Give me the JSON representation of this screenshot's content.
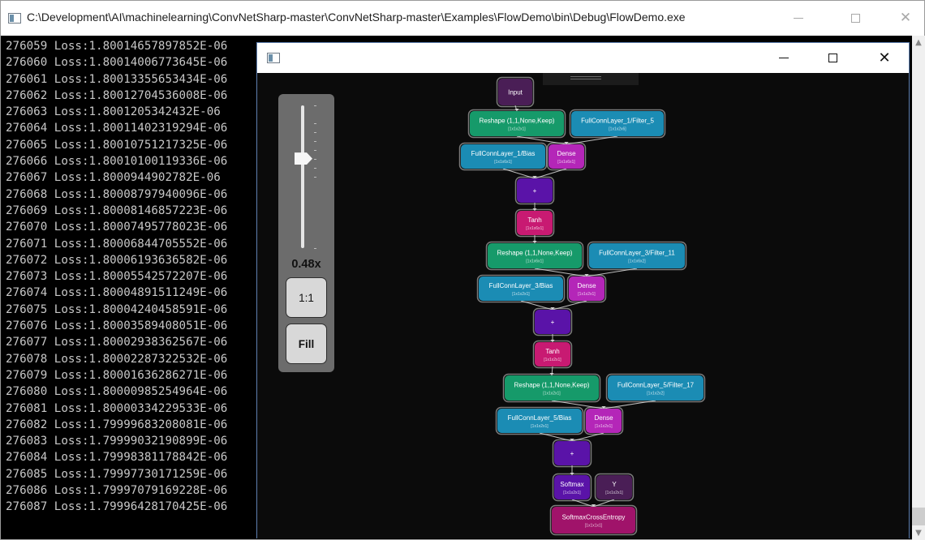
{
  "console": {
    "title": "C:\\Development\\AI\\machinelearning\\ConvNetSharp-master\\ConvNetSharp-master\\Examples\\FlowDemo\\bin\\Debug\\FlowDemo.exe",
    "lines": [
      "276059 Loss:1.80014657897852E-06",
      "276060 Loss:1.80014006773645E-06",
      "276061 Loss:1.80013355653434E-06",
      "276062 Loss:1.80012704536008E-06",
      "276063 Loss:1.8001205342432E-06",
      "276064 Loss:1.80011402319294E-06",
      "276065 Loss:1.80010751217325E-06",
      "276066 Loss:1.80010100119336E-06",
      "276067 Loss:1.8000944902782E-06",
      "276068 Loss:1.80008797940096E-06",
      "276069 Loss:1.80008146857223E-06",
      "276070 Loss:1.80007495778023E-06",
      "276071 Loss:1.80006844705552E-06",
      "276072 Loss:1.80006193636582E-06",
      "276073 Loss:1.80005542572207E-06",
      "276074 Loss:1.80004891511249E-06",
      "276075 Loss:1.80004240458591E-06",
      "276076 Loss:1.80003589408051E-06",
      "276077 Loss:1.80002938362567E-06",
      "276078 Loss:1.80002287322532E-06",
      "276079 Loss:1.80001636286271E-06",
      "276080 Loss:1.80000985254964E-06",
      "276081 Loss:1.80000334229533E-06",
      "276082 Loss:1.79999683208081E-06",
      "276083 Loss:1.79999032190899E-06",
      "276084 Loss:1.79998381178842E-06",
      "276085 Loss:1.79997730171259E-06",
      "276086 Loss:1.79997079169228E-06",
      "276087 Loss:1.79996428170425E-06"
    ]
  },
  "flow_window": {
    "zoom": {
      "label": "0.48x",
      "level_fraction": 0.63,
      "one_to_one_label": "1:1",
      "fill_label": "Fill"
    },
    "graph": {
      "nodes": [
        {
          "id": "input",
          "label": "Input",
          "sub": "",
          "color": "#4a1e56"
        },
        {
          "id": "reshape1",
          "label": "Reshape (1,1,None,Keep)",
          "sub": "[1x1x2x1]",
          "color": "#169a6a"
        },
        {
          "id": "filter1",
          "label": "FullConnLayer_1/Filter_5",
          "sub": "[1x1x2x6]",
          "color": "#1b8cb4"
        },
        {
          "id": "bias1",
          "label": "FullConnLayer_1/Bias",
          "sub": "[1x1x6x1]",
          "color": "#1b8cb4"
        },
        {
          "id": "dense1",
          "label": "Dense",
          "sub": "[1x1x6x1]",
          "color": "#b426b8"
        },
        {
          "id": "add1",
          "label": "+",
          "sub": "",
          "color": "#5a13a8"
        },
        {
          "id": "tanh1",
          "label": "Tanh",
          "sub": "[1x1x6x1]",
          "color": "#c81a72"
        },
        {
          "id": "reshape2",
          "label": "Reshape (1,1,None,Keep)",
          "sub": "[1x1x6x1]",
          "color": "#169a6a"
        },
        {
          "id": "filter3",
          "label": "FullConnLayer_3/Filter_11",
          "sub": "[1x1x6x2]",
          "color": "#1b8cb4"
        },
        {
          "id": "bias3",
          "label": "FullConnLayer_3/Bias",
          "sub": "[1x1x2x1]",
          "color": "#1b8cb4"
        },
        {
          "id": "dense3",
          "label": "Dense",
          "sub": "[1x1x2x1]",
          "color": "#b426b8"
        },
        {
          "id": "add3",
          "label": "+",
          "sub": "",
          "color": "#5a13a8"
        },
        {
          "id": "tanh3",
          "label": "Tanh",
          "sub": "[1x1x2x1]",
          "color": "#c81a72"
        },
        {
          "id": "reshape3",
          "label": "Reshape (1,1,None,Keep)",
          "sub": "[1x1x2x1]",
          "color": "#169a6a"
        },
        {
          "id": "filter5",
          "label": "FullConnLayer_5/Filter_17",
          "sub": "[1x1x2x2]",
          "color": "#1b8cb4"
        },
        {
          "id": "bias5",
          "label": "FullConnLayer_5/Bias",
          "sub": "[1x1x2x1]",
          "color": "#1b8cb4"
        },
        {
          "id": "dense5",
          "label": "Dense",
          "sub": "[1x1x2x1]",
          "color": "#b426b8"
        },
        {
          "id": "add5",
          "label": "+",
          "sub": "",
          "color": "#5a13a8"
        },
        {
          "id": "softmax",
          "label": "Softmax",
          "sub": "[1x1x2x1]",
          "color": "#5a13a8"
        },
        {
          "id": "y",
          "label": "Y",
          "sub": "[1x1x2x1]",
          "color": "#4a1e56"
        },
        {
          "id": "sce",
          "label": "SoftmaxCrossEntropy",
          "sub": "[1x1x1x1]",
          "color": "#a0136a"
        }
      ],
      "edges": [
        [
          "input",
          "reshape1"
        ],
        [
          "reshape1",
          "dense1"
        ],
        [
          "filter1",
          "dense1"
        ],
        [
          "bias1",
          "add1"
        ],
        [
          "dense1",
          "add1"
        ],
        [
          "add1",
          "tanh1"
        ],
        [
          "tanh1",
          "reshape2"
        ],
        [
          "reshape2",
          "dense3"
        ],
        [
          "filter3",
          "dense3"
        ],
        [
          "bias3",
          "add3"
        ],
        [
          "dense3",
          "add3"
        ],
        [
          "add3",
          "tanh3"
        ],
        [
          "tanh3",
          "reshape3"
        ],
        [
          "reshape3",
          "dense5"
        ],
        [
          "filter5",
          "dense5"
        ],
        [
          "bias5",
          "add5"
        ],
        [
          "dense5",
          "add5"
        ],
        [
          "add5",
          "softmax"
        ],
        [
          "softmax",
          "sce"
        ],
        [
          "y",
          "sce"
        ]
      ]
    }
  }
}
